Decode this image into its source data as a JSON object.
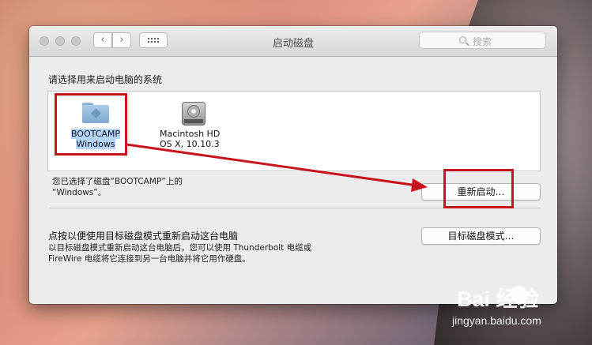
{
  "window": {
    "title": "启动磁盘",
    "nav_back": "‹",
    "nav_forward": "›",
    "search_placeholder": "搜索"
  },
  "main": {
    "heading": "请选择用来启动电脑的系统",
    "disks": [
      {
        "line1": "BOOTCAMP",
        "line2": "Windows",
        "icon": "folder-icon",
        "selected": true
      },
      {
        "line1": "Macintosh HD",
        "line2": "OS X, 10.10.3",
        "icon": "hard-disk-icon",
        "selected": false
      }
    ],
    "selection_message_line1": "您已选择了磁盘“BOOTCAMP”上的",
    "selection_message_line2": "“Windows”。",
    "restart_button": "重新启动…"
  },
  "target_mode": {
    "heading": "点按以便使用目标磁盘模式重新启动这台电脑",
    "desc_line1": "以目标磁盘模式重新启动这台电脑后，您可以使用 Thunderbolt 电缆或",
    "desc_line2": "FireWire 电缆将它连接到另一台电脑并将它用作硬盘。",
    "button": "目标磁盘模式…"
  },
  "watermark": {
    "logo": "Bai  经验",
    "url": "jingyan.baidu.com"
  },
  "colors": {
    "annotation_red": "#c8141d",
    "selection_blue": "#b5d5ff"
  }
}
